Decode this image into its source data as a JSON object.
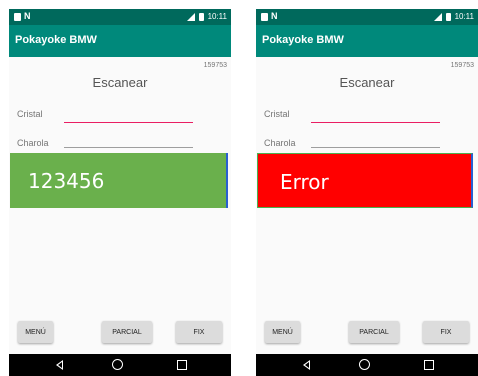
{
  "phones": {
    "left": {
      "app_title": "Pokayoke BMW",
      "status_time": "10:11",
      "code_label": "159753",
      "heading": "Escanear",
      "field_cristal_label": "Cristal",
      "field_charola_label": "Charola",
      "result_text": "123456",
      "result_color": "#6ab04c",
      "buttons": {
        "menu": "MENÚ",
        "parcial": "PARCIAL",
        "fix": "FIX"
      }
    },
    "right": {
      "app_title": "Pokayoke BMW",
      "status_time": "10:11",
      "code_label": "159753",
      "heading": "Escanear",
      "field_cristal_label": "Cristal",
      "field_charola_label": "Charola",
      "result_text": "Error",
      "result_color": "#ff0000",
      "buttons": {
        "menu": "MENÚ",
        "parcial": "PARCIAL",
        "fix": "FIX"
      }
    }
  },
  "theme": {
    "status_bar": "#00695c",
    "app_bar": "#00897b",
    "accent": "#e91e63"
  },
  "icons": {
    "status_left": [
      "shopping-bag-icon",
      "n-notification-icon"
    ],
    "status_right": [
      "signal-icon",
      "battery-icon"
    ],
    "nav": [
      "back-icon",
      "home-icon",
      "recent-apps-icon"
    ]
  }
}
